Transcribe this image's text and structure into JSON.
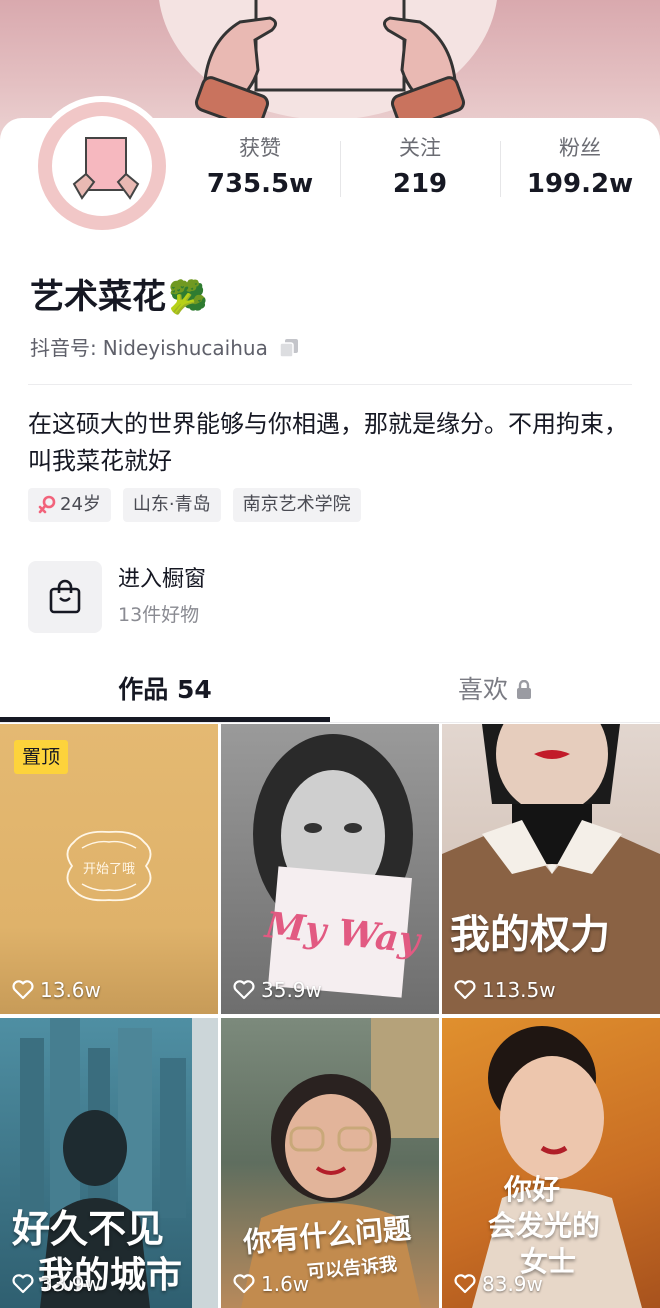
{
  "profile": {
    "name": "艺术菜花",
    "name_emoji": "🥦",
    "douyin_id_label": "抖音号:",
    "douyin_id": "Nideyishucaihua",
    "bio": "在这硕大的世界能够与你相遇，那就是缘分。不用拘束，叫我菜花就好"
  },
  "stats": [
    {
      "label": "获赞",
      "value": "735.5w"
    },
    {
      "label": "关注",
      "value": "219"
    },
    {
      "label": "粉丝",
      "value": "199.2w"
    }
  ],
  "tags": [
    {
      "text": "24岁",
      "icon": "female-icon"
    },
    {
      "text": "山东·青岛"
    },
    {
      "text": "南京艺术学院"
    }
  ],
  "shop": {
    "title": "进入橱窗",
    "subtitle": "13件好物",
    "icon": "shopping-bag-icon"
  },
  "tabs": {
    "works": "作品 54",
    "likes": "喜欢",
    "likes_icon": "lock-icon"
  },
  "videos": [
    {
      "likes": "13.6w",
      "pinned_label": "置顶",
      "caption": "开始了哦"
    },
    {
      "likes": "35.9w",
      "caption": "My Way"
    },
    {
      "likes": "113.5w",
      "caption": "我的权力"
    },
    {
      "likes": "33.9w",
      "caption_line1": "好久不见",
      "caption_line2": "我的城市"
    },
    {
      "likes": "1.6w",
      "caption_line1": "你有什么问题",
      "caption_line2": "可以告诉我"
    },
    {
      "likes": "83.9w",
      "caption_line1": "你好",
      "caption_line2": "会发光的",
      "caption_line3": "女士"
    }
  ],
  "colors": {
    "banner": "#d9a9ae",
    "accent_pin": "#fdd33b",
    "text_primary": "#161823",
    "text_secondary": "#6b6c73"
  }
}
